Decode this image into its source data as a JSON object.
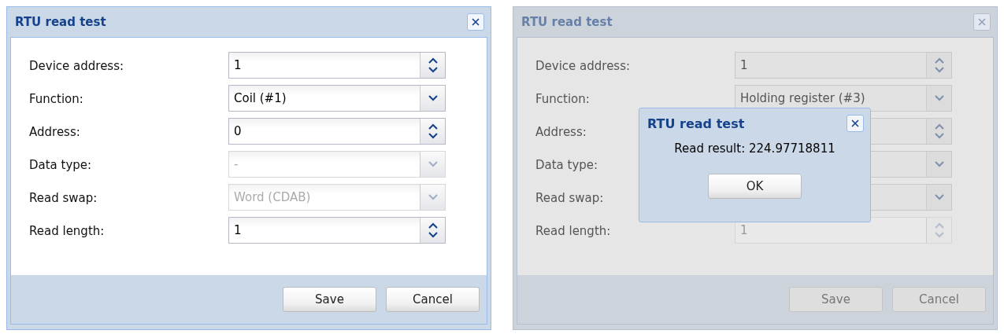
{
  "panels": [
    {
      "title": "RTU read test",
      "masked": false,
      "fields": [
        {
          "kind": "spinner",
          "label": "Device address:",
          "value": "1",
          "disabled": false
        },
        {
          "kind": "select",
          "label": "Function:",
          "value": "Coil (#1)",
          "disabled": false
        },
        {
          "kind": "spinner",
          "label": "Address:",
          "value": "0",
          "disabled": false
        },
        {
          "kind": "select",
          "label": "Data type:",
          "value": "-",
          "disabled": true
        },
        {
          "kind": "select",
          "label": "Read swap:",
          "value": "Word (CDAB)",
          "disabled": true
        },
        {
          "kind": "spinner",
          "label": "Read length:",
          "value": "1",
          "disabled": false
        }
      ],
      "buttons": [
        "Save",
        "Cancel"
      ]
    },
    {
      "title": "RTU read test",
      "masked": true,
      "fields": [
        {
          "kind": "spinner",
          "label": "Device address:",
          "value": "1",
          "disabled": false
        },
        {
          "kind": "select",
          "label": "Function:",
          "value": "Holding register (#3)",
          "disabled": false
        },
        {
          "kind": "spinner",
          "label": "Address:",
          "disabled": false
        },
        {
          "kind": "select",
          "label": "Data type:",
          "disabled": false
        },
        {
          "kind": "select",
          "label": "Read swap:",
          "disabled": false
        },
        {
          "kind": "spinner",
          "label": "Read length:",
          "value": "1",
          "disabled": true
        }
      ],
      "buttons": [
        "Save",
        "Cancel"
      ],
      "message_box": {
        "title": "RTU read test",
        "text": "Read result: 224.97718811",
        "button": "OK"
      }
    }
  ]
}
